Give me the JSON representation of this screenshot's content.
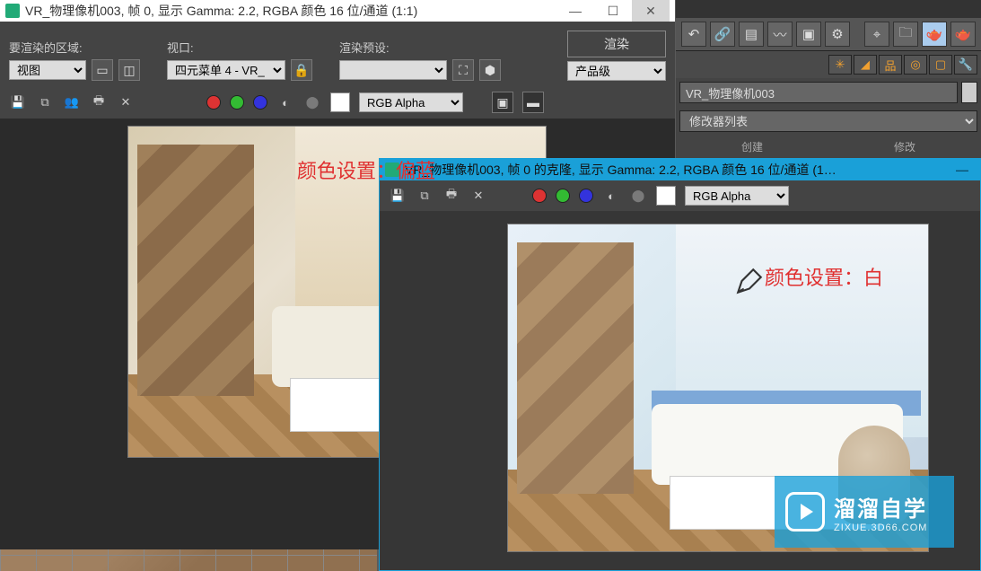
{
  "window1": {
    "title": "VR_物理像机003, 帧 0, 显示 Gamma: 2.2, RGBA 颜色 16 位/通道 (1:1)",
    "labels": {
      "area": "要渲染的区域:",
      "viewport": "视口:",
      "preset": "渲染预设:",
      "render_btn": "渲染"
    },
    "area_select": "视图",
    "viewport_select": "四元菜单 4 - VR_",
    "quality_select": "产品级",
    "channel_select": "RGB Alpha",
    "annotation": "颜色设置：偏蓝"
  },
  "window2": {
    "title": "VR_物理像机003, 帧 0 的克隆, 显示 Gamma: 2.2, RGBA 颜色 16 位/通道 (1…",
    "channel_select": "RGB Alpha",
    "annotation": "颜色设置：白"
  },
  "right_panel": {
    "object_name": "VR_物理像机003",
    "modifier_list": "修改器列表",
    "footer_left": "创建",
    "footer_right": "修改"
  },
  "watermark": {
    "title": "溜溜自学",
    "sub": "ZIXUE.3D66.COM"
  }
}
